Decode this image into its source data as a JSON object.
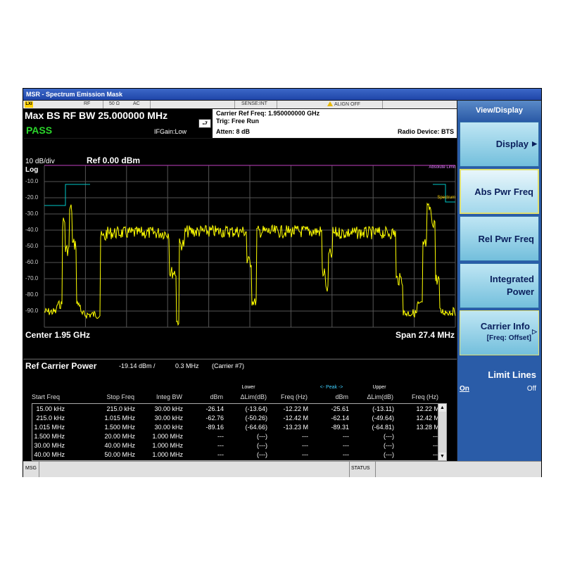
{
  "window": {
    "title": "MSR - Spectrum Emission Mask"
  },
  "status_row": {
    "logo": "LXI",
    "input": "RF",
    "impedance": "50 Ω",
    "coupling": "AC",
    "sense": "SENSE:INT",
    "align": "ALIGN OFF"
  },
  "header": {
    "bw_title": "Max BS RF BW 25.000000 MHz",
    "result": "PASS",
    "ifgain": "IFGain:Low",
    "carrier_ref": "Carrier Ref Freq: 1.950000000 GHz",
    "trig": "Trig: Free Run",
    "atten": "Atten: 8 dB",
    "radio_device": "Radio Device: BTS",
    "hold_symbol": "⮐"
  },
  "plot": {
    "scale": "10 dB/div",
    "scale_type": "Log",
    "ref_level": "Ref 0.00 dBm",
    "y_ticks": [
      "-10.0",
      "-20.0",
      "-30.0",
      "-40.0",
      "-50.0",
      "-60.0",
      "-70.0",
      "-80.0",
      "-90.0"
    ],
    "center": "Center  1.95 GHz",
    "span": "Span 27.4 MHz",
    "legend_abs": "Absolute Limit",
    "legend_spec": "Spectrum",
    "trace_color": "#ffff00",
    "limit_color": "#00c8c8",
    "ref_line_color": "#c040c0"
  },
  "table": {
    "title": "Ref Carrier Power",
    "power": "-19.14 dBm /",
    "bw": "0.3 MHz",
    "carrier": "(Carrier #7)",
    "group_lower": "Lower",
    "group_peak": "<- Peak ->",
    "group_upper": "Upper",
    "headers": [
      "Start Freq",
      "Stop Freq",
      "Integ BW",
      "dBm",
      "ΔLim(dB)",
      "Freq (Hz)",
      "dBm",
      "ΔLim(dB)",
      "Freq (Hz)"
    ],
    "rows": [
      [
        "15.00 kHz",
        "215.0 kHz",
        "30.00 kHz",
        "-26.14",
        "(-13.64)",
        "-12.22 M",
        "-25.61",
        "(-13.11)",
        "12.22 M"
      ],
      [
        "215.0 kHz",
        "1.015 MHz",
        "30.00 kHz",
        "-62.76",
        "(-50.26)",
        "-12.42 M",
        "-62.14",
        "(-49.64)",
        "12.42 M"
      ],
      [
        "1.015 MHz",
        "1.500 MHz",
        "30.00 kHz",
        "-89.16",
        "(-64.66)",
        "-13.23 M",
        "-89.31",
        "(-64.81)",
        "13.28 M"
      ],
      [
        "1.500 MHz",
        "20.00 MHz",
        "1.000 MHz",
        "---",
        "(---)",
        "---",
        "---",
        "(---)",
        "---"
      ],
      [
        "30.00 MHz",
        "40.00 MHz",
        "1.000 MHz",
        "---",
        "(---)",
        "---",
        "---",
        "(---)",
        "---"
      ],
      [
        "40.00 MHz",
        "50.00 MHz",
        "1.000 MHz",
        "---",
        "(---)",
        "---",
        "---",
        "(---)",
        "---"
      ]
    ]
  },
  "msg_bar": {
    "msg": "MSG",
    "status": "STATUS"
  },
  "softkeys": {
    "menu_title": "View/Display",
    "display": "Display",
    "abs_pwr_freq": "Abs Pwr Freq",
    "rel_pwr_freq": "Rel Pwr Freq",
    "integrated_l1": "Integrated",
    "integrated_l2": "Power",
    "carrier_info_l1": "Carrier Info",
    "carrier_info_l2": "[Freq: Offset]",
    "limit_lines": "Limit Lines",
    "limit_on": "On",
    "limit_off": "Off"
  }
}
